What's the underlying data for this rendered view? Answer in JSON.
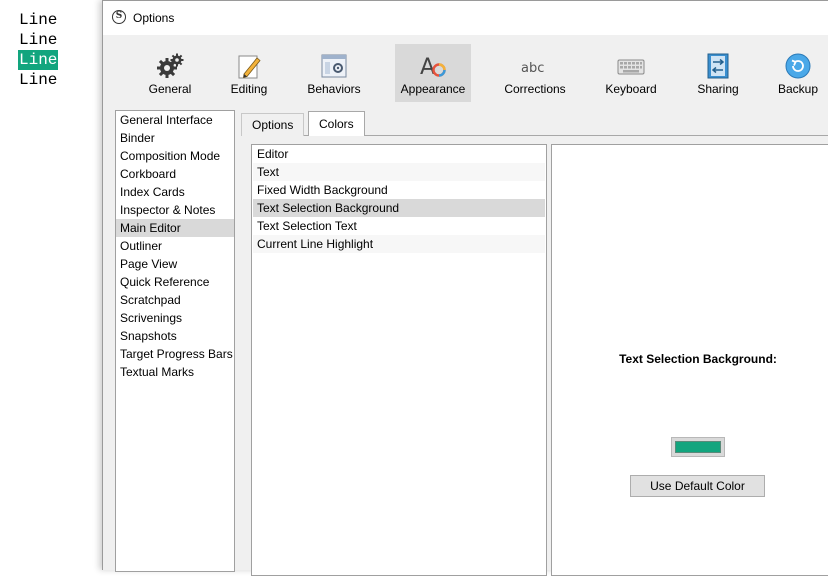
{
  "preview": {
    "lines": [
      "Line",
      "Line",
      "Line",
      "Line"
    ],
    "selection_color": "#12a57e"
  },
  "window": {
    "title": "Options"
  },
  "toolbar": {
    "items": [
      {
        "label": "General",
        "icon": "gears-icon"
      },
      {
        "label": "Editing",
        "icon": "pencil-icon"
      },
      {
        "label": "Behaviors",
        "icon": "behaviors-icon"
      },
      {
        "label": "Appearance",
        "icon": "appearance-icon",
        "active": true
      },
      {
        "label": "Corrections",
        "icon": "abc-icon"
      },
      {
        "label": "Keyboard",
        "icon": "keyboard-icon"
      },
      {
        "label": "Sharing",
        "icon": "sharing-icon"
      },
      {
        "label": "Backup",
        "icon": "backup-icon"
      }
    ]
  },
  "categories": {
    "items": [
      "General Interface",
      "Binder",
      "Composition Mode",
      "Corkboard",
      "Index Cards",
      "Inspector & Notes",
      "Main Editor",
      "Outliner",
      "Page View",
      "Quick Reference",
      "Scratchpad",
      "Scrivenings",
      "Snapshots",
      "Target Progress Bars",
      "Textual Marks"
    ],
    "selected": "Main Editor"
  },
  "tabs": {
    "options": "Options",
    "colors": "Colors",
    "active": "Colors"
  },
  "color_elements": {
    "items": [
      "Editor",
      "Text",
      "Fixed Width Background",
      "Text Selection Background",
      "Text Selection Text",
      "Current Line Highlight"
    ],
    "selected": "Text Selection Background"
  },
  "detail": {
    "title": "Text Selection Background:",
    "swatch_color": "#12a57e",
    "default_button": "Use Default Color"
  }
}
